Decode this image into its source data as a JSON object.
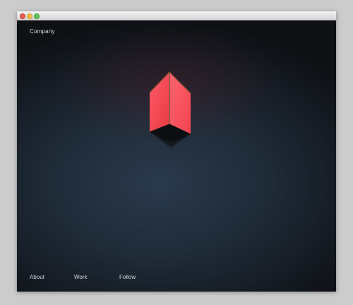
{
  "header": {
    "brand_label": "Company"
  },
  "nav": {
    "items": [
      {
        "label": "About"
      },
      {
        "label": "Work"
      },
      {
        "label": "Follow"
      }
    ]
  },
  "colors": {
    "page_background": "#cccccc",
    "window_background": "#111111",
    "accent_red": "#ff4b55",
    "text": "#d8dde2"
  },
  "icons": {
    "window_controls": [
      "close-icon",
      "minimize-icon",
      "maximize-icon"
    ]
  }
}
